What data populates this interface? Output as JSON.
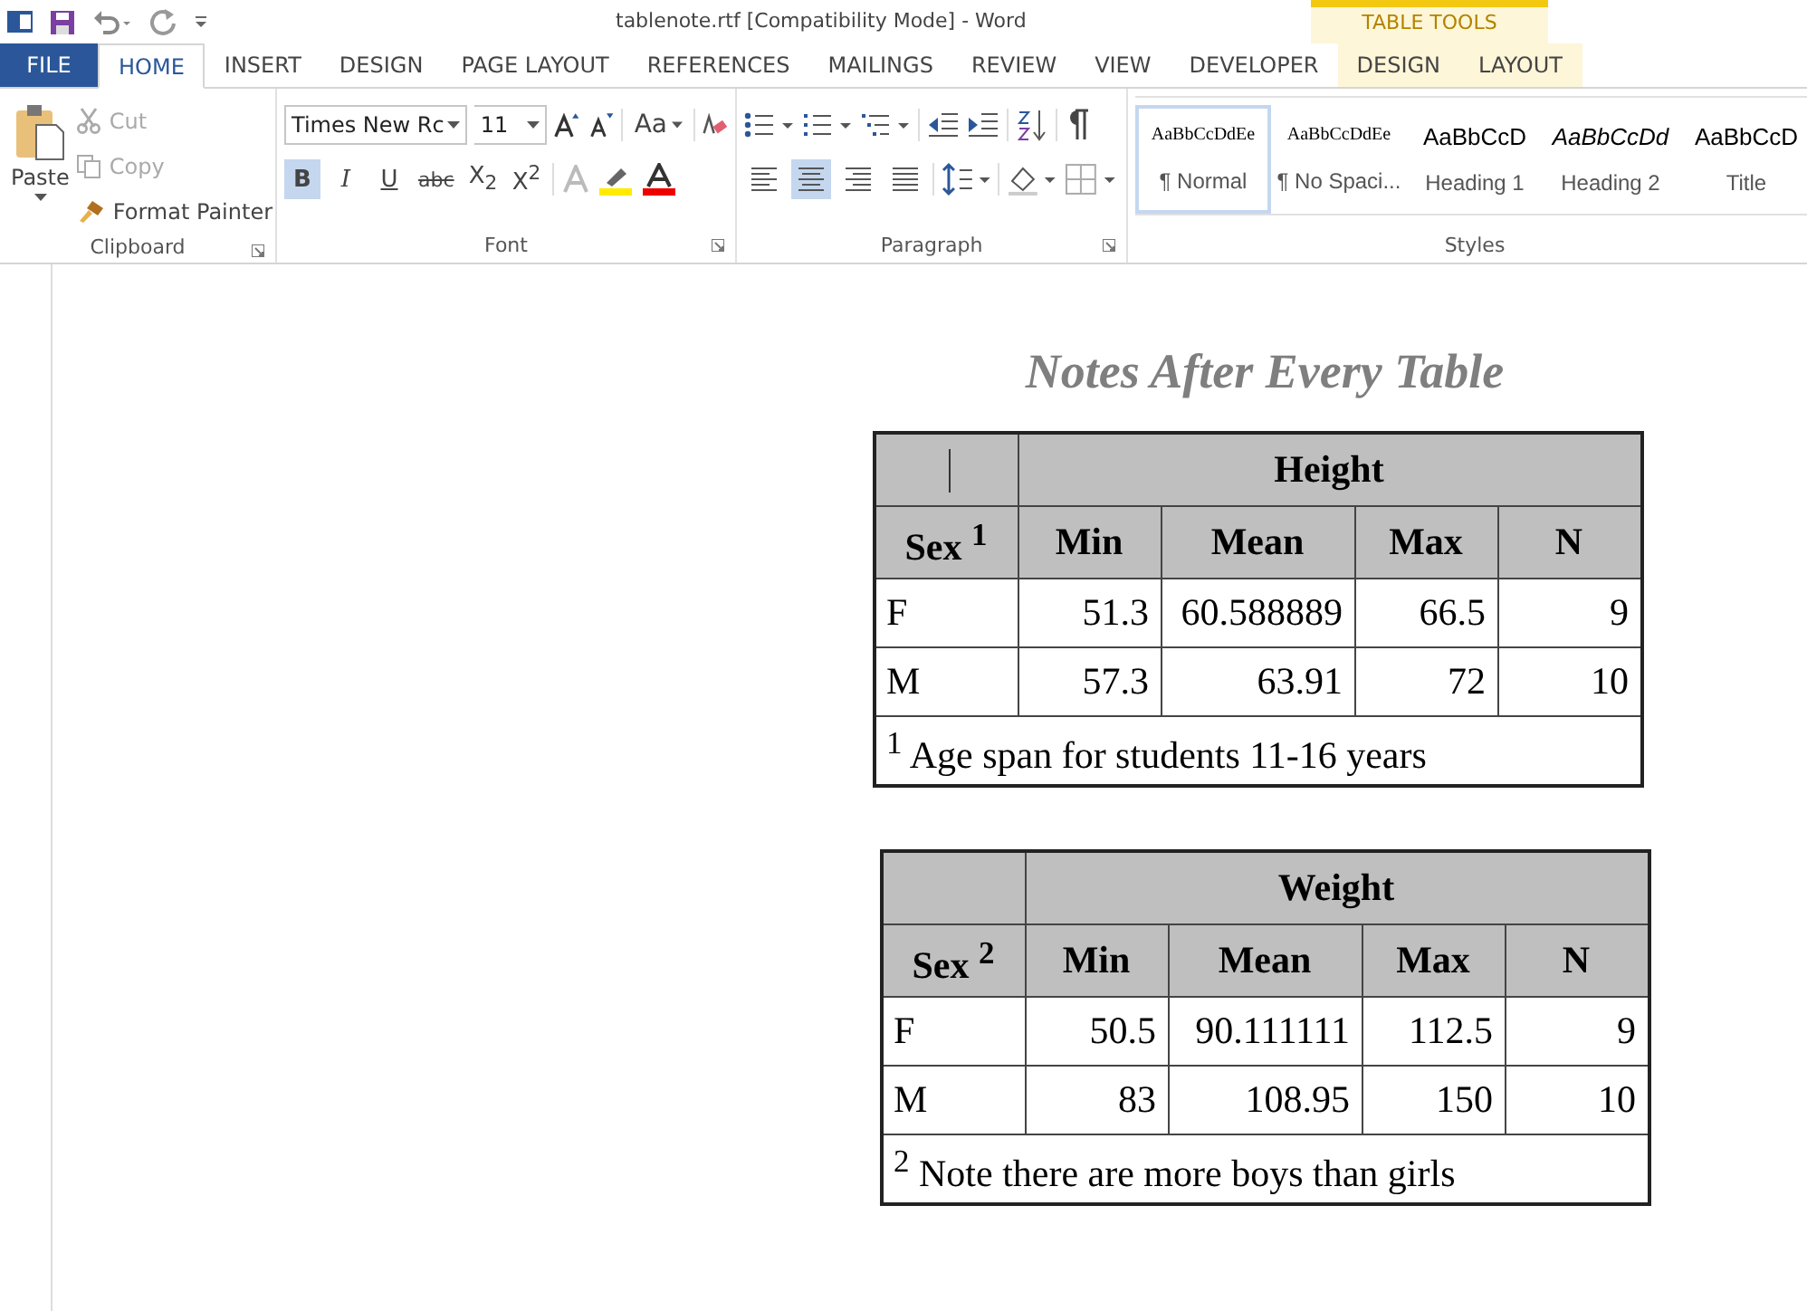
{
  "window": {
    "title": "tablenote.rtf [Compatibility Mode] - Word"
  },
  "contextual_tab_group": "TABLE TOOLS",
  "tabs": [
    {
      "label": "FILE",
      "kind": "file",
      "selected": false
    },
    {
      "label": "HOME",
      "kind": "normal",
      "selected": true
    },
    {
      "label": "INSERT",
      "kind": "normal",
      "selected": false
    },
    {
      "label": "DESIGN",
      "kind": "normal",
      "selected": false
    },
    {
      "label": "PAGE LAYOUT",
      "kind": "normal",
      "selected": false
    },
    {
      "label": "REFERENCES",
      "kind": "normal",
      "selected": false
    },
    {
      "label": "MAILINGS",
      "kind": "normal",
      "selected": false
    },
    {
      "label": "REVIEW",
      "kind": "normal",
      "selected": false
    },
    {
      "label": "VIEW",
      "kind": "normal",
      "selected": false
    },
    {
      "label": "DEVELOPER",
      "kind": "normal",
      "selected": false
    },
    {
      "label": "DESIGN",
      "kind": "contextual",
      "selected": false
    },
    {
      "label": "LAYOUT",
      "kind": "contextual",
      "selected": false
    }
  ],
  "clipboard": {
    "paste": "Paste",
    "cut": "Cut",
    "copy": "Copy",
    "format_painter": "Format Painter",
    "label": "Clipboard"
  },
  "font": {
    "name": "Times New Rc",
    "size": "11",
    "change_case": "Aa",
    "label": "Font",
    "format_buttons": [
      {
        "label": "B",
        "kind": "bold",
        "selected": true
      },
      {
        "label": "I",
        "kind": "italic",
        "selected": false
      },
      {
        "label": "U",
        "kind": "underline",
        "selected": false
      },
      {
        "label": "abc",
        "kind": "strike",
        "selected": false
      },
      {
        "label": "X$_{2}$",
        "kind": "sub",
        "selected": false
      },
      {
        "label": "X$^{2}$",
        "kind": "sup",
        "selected": false
      }
    ]
  },
  "paragraph": {
    "label": "Paragraph",
    "alignments": [
      {
        "selected": false
      },
      {
        "selected": true
      },
      {
        "selected": false
      },
      {
        "selected": false
      }
    ]
  },
  "styles": {
    "label": "Styles",
    "items": [
      {
        "preview": "AaBbCcDdEe",
        "name": "¶ Normal",
        "kind": "normal",
        "selected": true
      },
      {
        "preview": "AaBbCcDdEe",
        "name": "¶ No Spaci...",
        "kind": "normal",
        "selected": false
      },
      {
        "preview": "AaBbCcD",
        "name": "Heading 1",
        "kind": "heading1",
        "selected": false
      },
      {
        "preview": "AaBbCcDd",
        "name": "Heading 2",
        "kind": "heading2",
        "selected": false
      },
      {
        "preview": "AaBbCcD",
        "name": "Title",
        "kind": "title",
        "selected": false
      }
    ]
  },
  "document": {
    "title": "Notes After Every Table",
    "tables": [
      {
        "group_header": "Height",
        "columns": [
          "Sex $^{1}$",
          "Min",
          "Mean",
          "Max",
          "N"
        ],
        "rows": [
          [
            "F",
            "51.3",
            "60.588889",
            "66.5",
            "9"
          ],
          [
            "M",
            "57.3",
            "63.91",
            "72",
            "10"
          ]
        ],
        "note": "$^{1}$ Age span for students 11-16 years"
      },
      {
        "group_header": "Weight",
        "columns": [
          "Sex $^{2}$",
          "Min",
          "Mean",
          "Max",
          "N"
        ],
        "rows": [
          [
            "F",
            "50.5",
            "90.111111",
            "112.5",
            "9"
          ],
          [
            "M",
            "83",
            "108.95",
            "150",
            "10"
          ]
        ],
        "note": "$^{2}$ Note there are more boys than girls"
      }
    ]
  }
}
